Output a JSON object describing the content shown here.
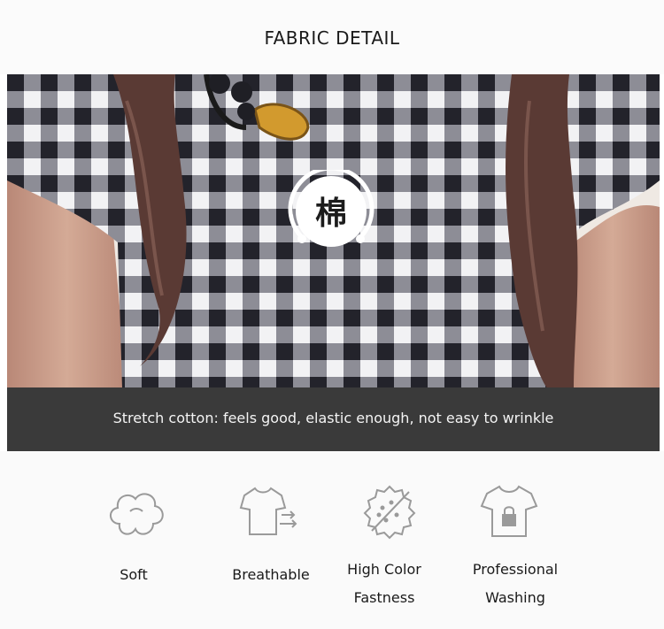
{
  "header": {
    "title": "FABRIC DETAIL"
  },
  "badge": {
    "character": "棉"
  },
  "caption": {
    "text": "Stretch cotton: feels good, elastic enough, not easy to wrinkle"
  },
  "features": [
    {
      "icon": "cotton-icon",
      "label": "Soft"
    },
    {
      "icon": "breathable-shirt-icon",
      "label": "Breathable"
    },
    {
      "icon": "color-fastness-icon",
      "label_line1": "High Color",
      "label_line2": "Fastness"
    },
    {
      "icon": "washing-lock-shirt-icon",
      "label_line1": "Professional",
      "label_line2": "Washing"
    }
  ],
  "colors": {
    "caption_bar": "#3a3a3a",
    "icon_stroke": "#9a9a9a",
    "hair": "#5a3a34",
    "skin": "#c79b86"
  }
}
